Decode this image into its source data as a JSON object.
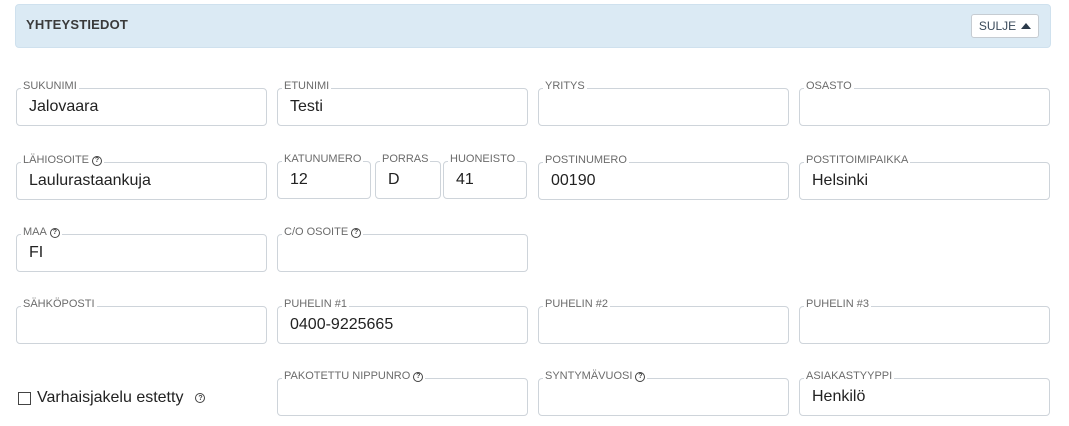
{
  "section": {
    "title": "YHTEYSTIEDOT",
    "close_label": "SULJE"
  },
  "fields": {
    "sukunimi": {
      "label": "SUKUNIMI",
      "value": "Jalovaara"
    },
    "etunimi": {
      "label": "ETUNIMI",
      "value": "Testi"
    },
    "yritys": {
      "label": "YRITYS",
      "value": ""
    },
    "osasto": {
      "label": "OSASTO",
      "value": ""
    },
    "lahiosoite": {
      "label": "LÄHIOSOITE",
      "value": "Laulurastaankuja"
    },
    "katunumero": {
      "label": "KATUNUMERO",
      "value": "12"
    },
    "porras": {
      "label": "PORRAS",
      "value": "D"
    },
    "huoneisto": {
      "label": "HUONEISTO",
      "value": "41"
    },
    "postinumero": {
      "label": "POSTINUMERO",
      "value": "00190"
    },
    "postitoimipaikka": {
      "label": "POSTITOIMIPAIKKA",
      "value": "Helsinki"
    },
    "maa": {
      "label": "MAA",
      "value": "FI"
    },
    "co_osoite": {
      "label": "C/O OSOITE",
      "value": ""
    },
    "sahkoposti": {
      "label": "SÄHKÖPOSTI",
      "value": ""
    },
    "puhelin1": {
      "label": "PUHELIN #1",
      "value": "0400-9225665"
    },
    "puhelin2": {
      "label": "PUHELIN #2",
      "value": ""
    },
    "puhelin3": {
      "label": "PUHELIN #3",
      "value": ""
    },
    "nippunro": {
      "label": "PAKOTETTU NIPPUNRO",
      "value": ""
    },
    "syntymavuosi": {
      "label": "SYNTYMÄVUOSI",
      "value": ""
    },
    "asiakastyyppi": {
      "label": "ASIAKASTYYPPI",
      "value": "Henkilö"
    }
  },
  "checkbox": {
    "label": "Varhaisjakelu estetty",
    "checked": false
  },
  "icons": {
    "help": "help-circle-icon",
    "close": "caret-up-icon"
  }
}
